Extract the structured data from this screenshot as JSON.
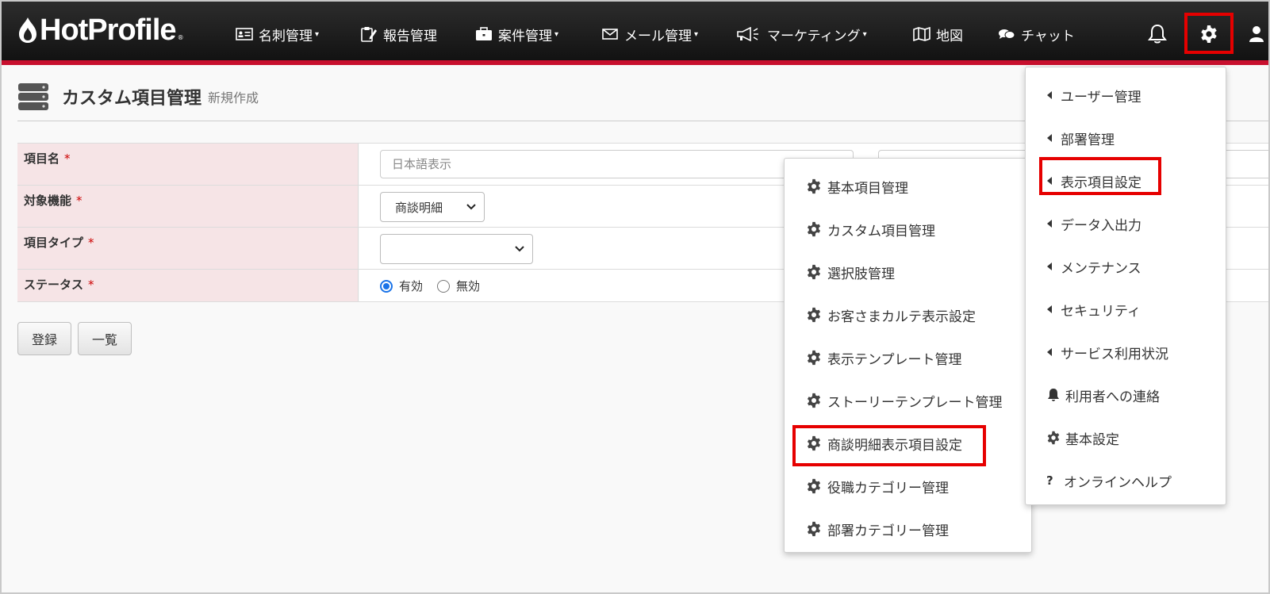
{
  "brand": {
    "name": "HotProfile",
    "reg_mark": "®"
  },
  "nav": {
    "items": [
      {
        "label": "名刺管理",
        "icon": "id-card-icon",
        "has_caret": true
      },
      {
        "label": "報告管理",
        "icon": "report-edit-icon",
        "has_caret": false
      },
      {
        "label": "案件管理",
        "icon": "briefcase-icon",
        "has_caret": true
      },
      {
        "label": "メール管理",
        "icon": "envelope-icon",
        "has_caret": true
      },
      {
        "label": "マーケティング",
        "icon": "megaphone-icon",
        "has_caret": true
      },
      {
        "label": "地図",
        "icon": "map-icon",
        "has_caret": false
      },
      {
        "label": "チャット",
        "icon": "chat-bubbles-icon",
        "has_caret": false
      }
    ],
    "caret": "▾"
  },
  "page": {
    "title": "カスタム項目管理",
    "subtitle": "新規作成"
  },
  "form": {
    "required_mark": "*",
    "fields": [
      {
        "label": "項目名",
        "type": "text",
        "placeholder": "日本語表示",
        "value": ""
      },
      {
        "label": "対象機能",
        "type": "select",
        "value": "商談明細"
      },
      {
        "label": "項目タイプ",
        "type": "select",
        "value": ""
      },
      {
        "label": "ステータス",
        "type": "radio",
        "options": [
          "有効",
          "無効"
        ],
        "selected": "有効"
      }
    ]
  },
  "buttons": {
    "register": "登録",
    "list": "一覧"
  },
  "settings_menu": {
    "items": [
      {
        "label": "ユーザー管理",
        "icon": "caret-left-icon"
      },
      {
        "label": "部署管理",
        "icon": "caret-left-icon"
      },
      {
        "label": "表示項目設定",
        "icon": "caret-left-icon",
        "highlighted": true
      },
      {
        "label": "データ入出力",
        "icon": "caret-left-icon"
      },
      {
        "label": "メンテナンス",
        "icon": "caret-left-icon"
      },
      {
        "label": "セキュリティ",
        "icon": "caret-left-icon"
      },
      {
        "label": "サービス利用状況",
        "icon": "caret-left-icon"
      },
      {
        "label": "利用者への連絡",
        "icon": "bell-icon"
      },
      {
        "label": "基本設定",
        "icon": "gear-icon"
      },
      {
        "label": "オンラインヘルプ",
        "icon": "question-icon",
        "icon_text": "?"
      }
    ]
  },
  "submenu": {
    "items": [
      {
        "label": "基本項目管理"
      },
      {
        "label": "カスタム項目管理"
      },
      {
        "label": "選択肢管理"
      },
      {
        "label": "お客さまカルテ表示設定"
      },
      {
        "label": "表示テンプレート管理"
      },
      {
        "label": "ストーリーテンプレート管理"
      },
      {
        "label": "商談明細表示項目設定",
        "highlighted": true
      },
      {
        "label": "役職カテゴリー管理"
      },
      {
        "label": "部署カテゴリー管理"
      }
    ]
  },
  "colors": {
    "nav_bg": "#1e1e1e",
    "nav_accent": "#c8102e",
    "highlight": "#e60000",
    "label_bg": "#f6e4e6",
    "radio": "#1a73e8"
  }
}
